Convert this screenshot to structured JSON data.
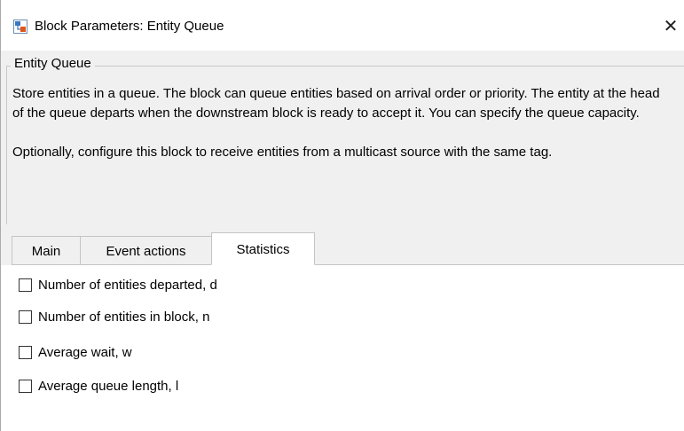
{
  "window": {
    "title": "Block Parameters: Entity Queue",
    "close_glyph": "✕",
    "icon": "simulink-block-icon"
  },
  "group": {
    "legend": "Entity Queue",
    "description": [
      "Store entities in a queue. The block can queue entities based on arrival order or priority. The entity at the head of the queue departs when the downstream block is ready to accept it. You can specify the queue capacity.",
      "Optionally, configure this block to receive entities from a multicast source with the same tag."
    ]
  },
  "tabs": [
    {
      "label": "Main",
      "selected": false
    },
    {
      "label": "Event actions",
      "selected": false
    },
    {
      "label": "Statistics",
      "selected": true
    }
  ],
  "statistics": {
    "items": [
      {
        "label": "Number of entities departed, d",
        "checked": false
      },
      {
        "label": "Number of entities in block, n",
        "checked": false
      },
      {
        "label": "Average wait, w",
        "checked": false
      },
      {
        "label": "Average queue length, l",
        "checked": false
      }
    ]
  },
  "colors": {
    "dialog_background": "#f0f0f0",
    "panel_background": "#ffffff",
    "border": "#c4c4c4"
  }
}
